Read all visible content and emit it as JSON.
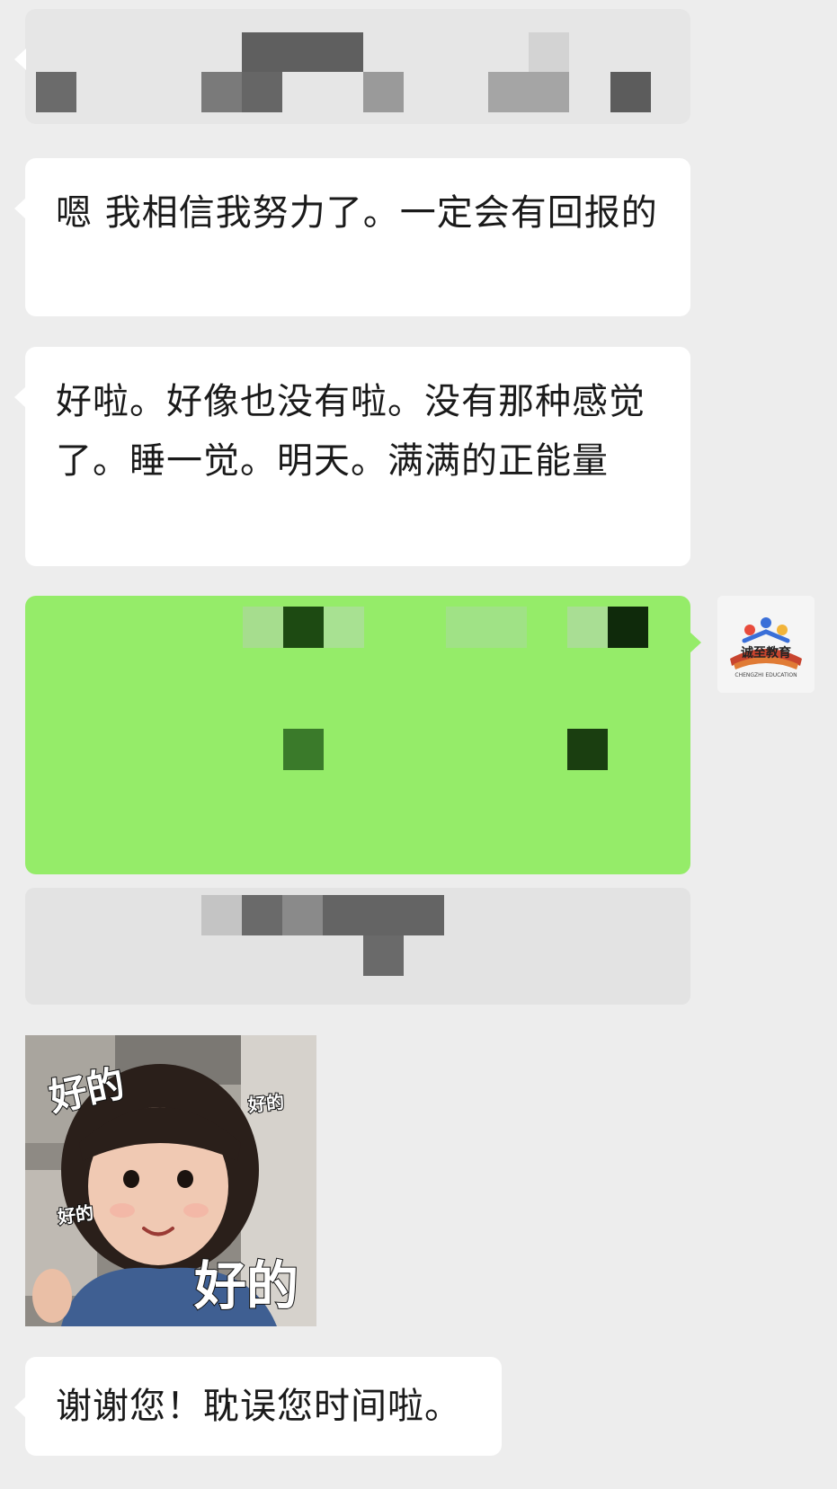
{
  "messages": [
    {
      "id": "msg1",
      "direction": "in",
      "text": "嗯 我相信我努力了。一定会有回报的"
    },
    {
      "id": "msg2",
      "direction": "in",
      "text": "好啦。好像也没有啦。没有那种感觉了。睡一觉。明天。满满的正能量"
    },
    {
      "id": "msg3",
      "direction": "in",
      "text": "谢谢您！耽误您时间啦。"
    }
  ],
  "sticker": {
    "captions": [
      "好的",
      "好的",
      "好的",
      "好的"
    ]
  },
  "avatar": {
    "logo_text": "诚至教育",
    "logo_subtext": "CHENGZHI EDUCATION"
  },
  "colors": {
    "background": "#ededed",
    "incoming_bubble": "#ffffff",
    "outgoing_bubble": "#95ec69"
  },
  "icons": [
    "avatar-logo-icon"
  ]
}
